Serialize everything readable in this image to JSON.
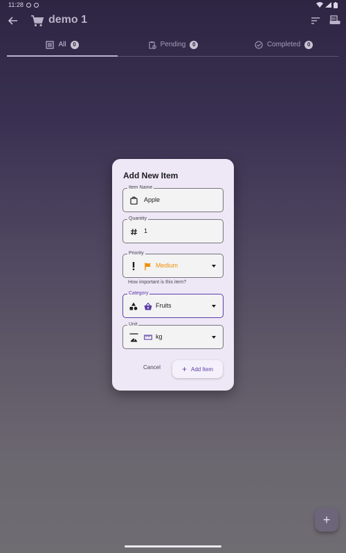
{
  "status_bar": {
    "time": "11:28"
  },
  "app_bar": {
    "title": "demo 1"
  },
  "tabs": [
    {
      "label": "All",
      "count": "0"
    },
    {
      "label": "Pending",
      "count": "0"
    },
    {
      "label": "Completed",
      "count": "0"
    }
  ],
  "dialog": {
    "title": "Add New Item",
    "item_name": {
      "label": "Item Name",
      "value": "Apple",
      "icon": "shopping-bag-icon"
    },
    "quantity": {
      "label": "Quantity",
      "value": "1",
      "icon": "hash-icon"
    },
    "priority": {
      "label": "Priority",
      "value": "Medium",
      "icon": "exclamation-icon",
      "value_icon": "flag-icon",
      "value_color": "#f0900a",
      "helper": "How important is this item?"
    },
    "category": {
      "label": "Category",
      "value": "Fruits",
      "icon": "category-icon",
      "value_icon": "basket-icon"
    },
    "unit": {
      "label": "Unit",
      "value": "kg",
      "icon": "scale-icon",
      "value_icon": "ruler-icon"
    },
    "cancel_label": "Cancel",
    "add_label": "Add Item"
  },
  "colors": {
    "accent": "#5b3da8",
    "priority_medium": "#f0900a"
  }
}
